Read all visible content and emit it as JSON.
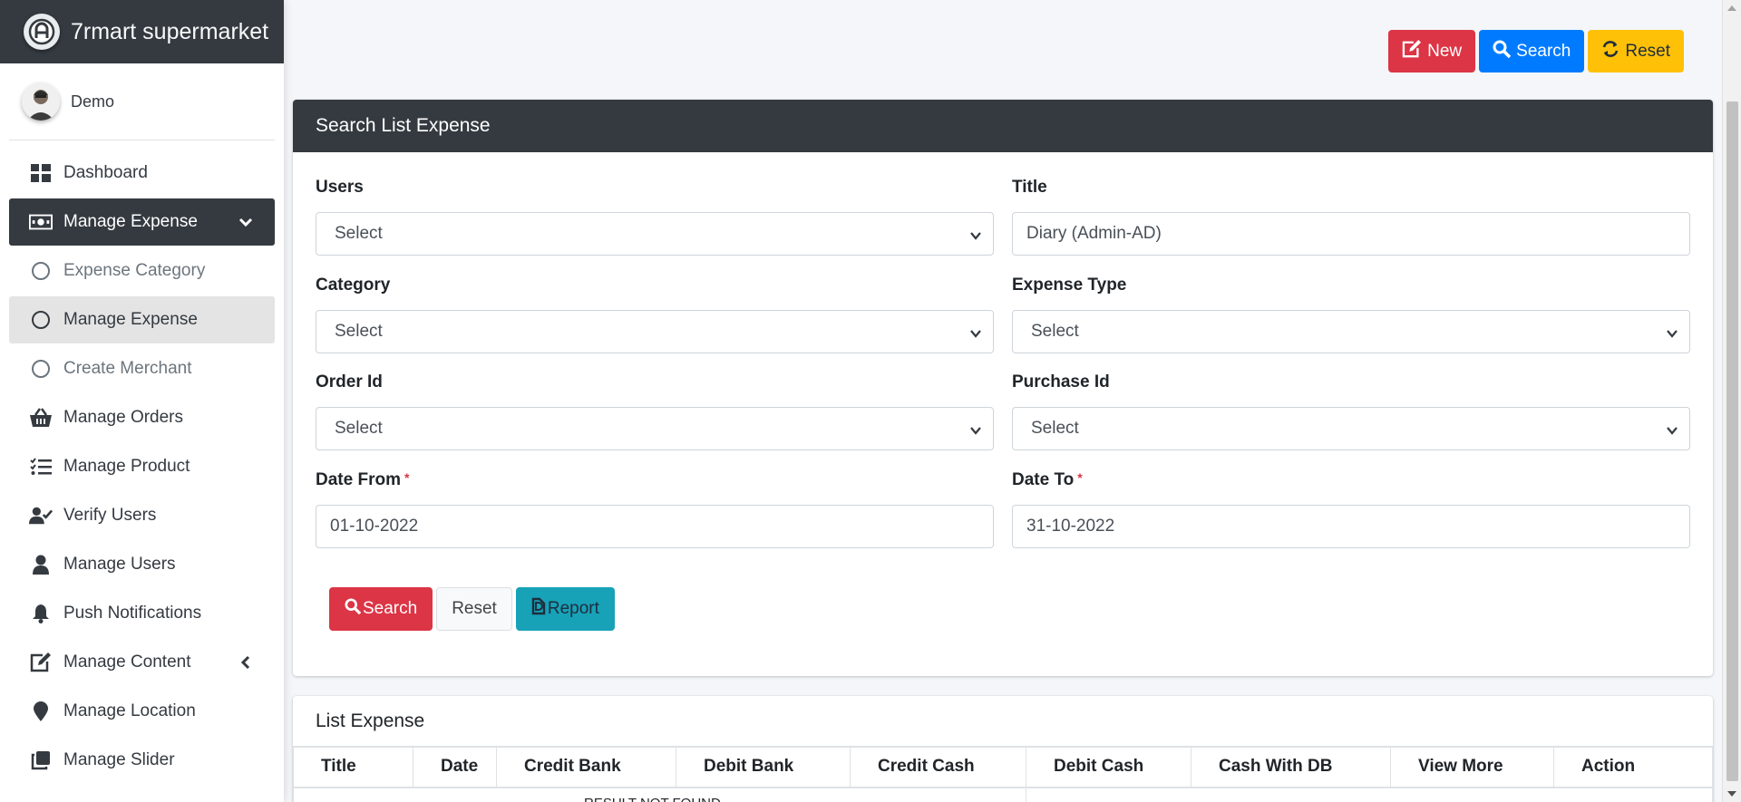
{
  "brand": {
    "name": "7rmart supermarket",
    "logo_icon": "logo-icon"
  },
  "user": {
    "name": "Demo"
  },
  "sidebar": {
    "items": [
      {
        "label": "Dashboard",
        "icon": "dashboard-icon"
      },
      {
        "label": "Manage Expense",
        "icon": "money-bill-icon",
        "state": "active",
        "arrow": "chevron-down-icon"
      },
      {
        "label": "Expense Category",
        "icon": "circle-icon",
        "sub": true
      },
      {
        "label": "Manage Expense",
        "icon": "circle-icon",
        "sub": true,
        "state": "selected"
      },
      {
        "label": "Create Merchant",
        "icon": "circle-icon",
        "sub": true
      },
      {
        "label": "Manage Orders",
        "icon": "basket-icon"
      },
      {
        "label": "Manage Product",
        "icon": "tasks-icon"
      },
      {
        "label": "Verify Users",
        "icon": "user-check-icon"
      },
      {
        "label": "Manage Users",
        "icon": "user-icon"
      },
      {
        "label": "Push Notifications",
        "icon": "bell-icon"
      },
      {
        "label": "Manage Content",
        "icon": "edit-icon",
        "arrow": "chevron-left-icon"
      },
      {
        "label": "Manage Location",
        "icon": "map-marker-icon"
      },
      {
        "label": "Manage Slider",
        "icon": "clone-icon"
      }
    ]
  },
  "toolbar": {
    "new_label": "New",
    "search_label": "Search",
    "reset_label": "Reset"
  },
  "search_card": {
    "title": "Search List Expense",
    "fields": {
      "users": {
        "label": "Users",
        "value": "Select"
      },
      "title": {
        "label": "Title",
        "value": "Diary (Admin-AD)"
      },
      "category": {
        "label": "Category",
        "value": "Select"
      },
      "expense_type": {
        "label": "Expense Type",
        "value": "Select"
      },
      "order_id": {
        "label": "Order Id",
        "value": "Select"
      },
      "purchase_id": {
        "label": "Purchase Id",
        "value": "Select"
      },
      "date_from": {
        "label": "Date From",
        "value": "01-10-2022",
        "required_mark": "*"
      },
      "date_to": {
        "label": "Date To",
        "value": "31-10-2022",
        "required_mark": "*"
      }
    },
    "buttons": {
      "search": "Search",
      "reset": "Reset",
      "report": "Report"
    }
  },
  "list_card": {
    "title": "List Expense",
    "columns": [
      "Title",
      "Date",
      "Credit Bank",
      "Debit Bank",
      "Credit Cash",
      "Debit Cash",
      "Cash With DB",
      "View More",
      "Action"
    ],
    "empty_text": "RESULT NOT FOUND"
  },
  "colors": {
    "primary": "#007bff",
    "danger": "#dc3545",
    "warning": "#ffc107",
    "info": "#17a2b8",
    "dark": "#343a40"
  }
}
